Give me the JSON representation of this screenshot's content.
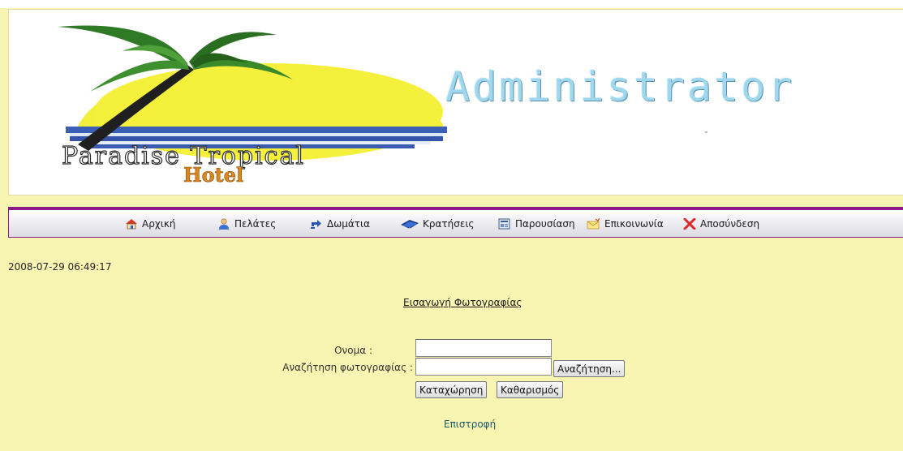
{
  "header": {
    "logo_line1": "Paradise Tropical",
    "logo_line2": "Hotel",
    "admin_title": "Administrator"
  },
  "nav": {
    "items": [
      {
        "label": "Αρχική",
        "icon": "home-icon"
      },
      {
        "label": "Πελάτες",
        "icon": "user-icon"
      },
      {
        "label": "Δωμάτια",
        "icon": "rooms-arrows-icon"
      },
      {
        "label": "Κρατήσεις",
        "icon": "book-icon"
      },
      {
        "label": "Παρουσίαση",
        "icon": "presentation-icon"
      },
      {
        "label": "Επικοινωνία",
        "icon": "contact-envelope-icon"
      },
      {
        "label": "Αποσύνδεση",
        "icon": "logout-x-icon"
      }
    ]
  },
  "timestamp": "2008-07-29 06:49:17",
  "form": {
    "title": "Εισαγωγή Φωτογραφίας",
    "name_label": "Ονομα :",
    "name_value": "",
    "photo_label": "Αναζήτηση φωτογραφίας :",
    "photo_value": "",
    "browse_button": "Αναζήτηση...",
    "submit_button": "Καταχώρηση",
    "reset_button": "Καθαρισμός"
  },
  "back_link": "Επιστροφή",
  "colors": {
    "page_background": "#f8f5b2",
    "nav_border": "#8c1a8a",
    "admin_title": "#9fd8ee",
    "link": "#1b5a6a"
  }
}
